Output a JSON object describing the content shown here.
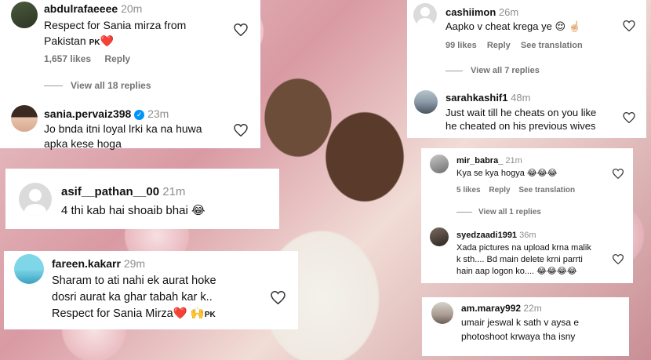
{
  "comments": {
    "abdulrafaeeee": {
      "username": "abdulrafaeeee",
      "time": "20m",
      "text_line1": "Respect for Sania mirza from",
      "text_line2": "Pakistan",
      "flag_text": "PK",
      "likes": "1,657 likes",
      "reply": "Reply",
      "view_replies": "View all 18 replies"
    },
    "sania_pervaiz398": {
      "username": "sania.pervaiz398",
      "time": "23m",
      "text_line1": "Jo bnda itni loyal lrki ka na huwa",
      "text_line2": "apka kese hoga"
    },
    "asif_pathan": {
      "username": "asif__pathan__00",
      "time": "21m",
      "text": "4 thi kab hai shoaib bhai"
    },
    "fareen_kakarr": {
      "username": "fareen.kakarr",
      "time": "29m",
      "text_line1": "Sharam to ati nahi ek aurat hoke",
      "text_line2": "dosri aurat ka ghar tabah kar k..",
      "text_line3": "Respect for Sania Mirza",
      "flag_text": "PK"
    },
    "cashiimon": {
      "username": "cashiimon",
      "time": "26m",
      "text": "Aapko v cheat krega ye",
      "likes": "99 likes",
      "reply": "Reply",
      "translation": "See translation",
      "view_replies": "View all 7 replies"
    },
    "sarahkashif1": {
      "username": "sarahkashif1",
      "time": "48m",
      "text_line1": "Just wait till he cheats on you like",
      "text_line2": "he cheated on his previous wives"
    },
    "mir_babra": {
      "username": "mir_babra_",
      "time": "21m",
      "text": "Kya se kya hogya",
      "likes": "5 likes",
      "reply": "Reply",
      "translation": "See translation",
      "view_replies": "View all 1 replies"
    },
    "syedzaadi1991": {
      "username": "syedzaadi1991",
      "time": "36m",
      "text_line1": "Xada pictures na upload krna malik",
      "text_line2": "k sth.... Bd main delete krni parrti",
      "text_line3": "hain aap logon ko...."
    },
    "am_maray992": {
      "username": "am.maray992",
      "time": "22m",
      "text_line1": "umair jeswal k sath v aysa e",
      "text_line2": "photoshoot krwaya tha isny"
    }
  },
  "emoji": {
    "red_heart": "❤️",
    "crying_laughing": "😂",
    "relieved": "😌",
    "hand": "☝🏻",
    "raising_hands": "🙌"
  },
  "colors": {
    "verified_badge": "#0095f6",
    "heart_red": "#e0245e",
    "muted_text": "#737373"
  }
}
